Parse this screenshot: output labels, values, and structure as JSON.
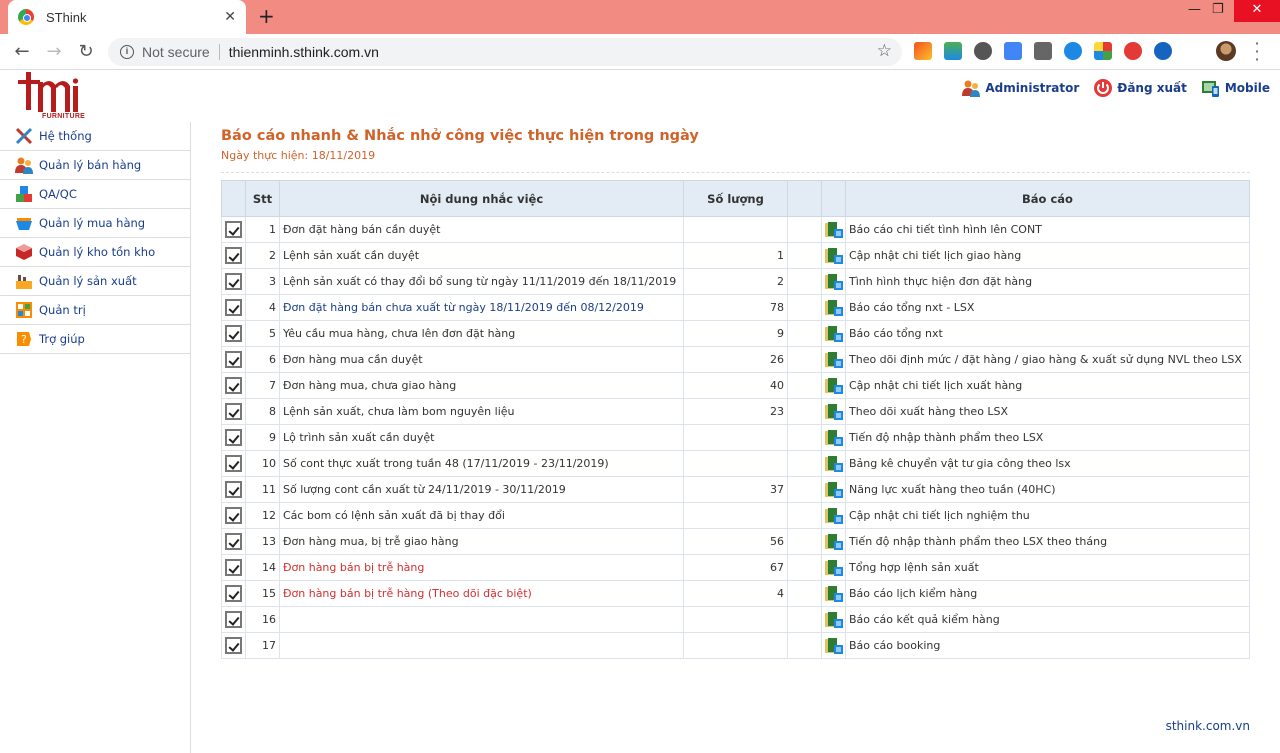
{
  "browser": {
    "tab_title": "SThink",
    "close_glyph": "✕",
    "new_tab_glyph": "+",
    "minimize_glyph": "—",
    "restore_glyph": "❐",
    "win_close_glyph": "✕",
    "not_secure": "Not secure",
    "url": "thienminh.sthink.com.vn"
  },
  "header": {
    "logo_text": "tmi",
    "logo_sub": "FURNITURE",
    "admin_label": "Administrator",
    "logout_label": "Đăng xuất",
    "mobile_label": "Mobile"
  },
  "sidebar": {
    "items": [
      {
        "label": "Hệ thống",
        "icon": "tools-icon"
      },
      {
        "label": "Quản lý bán hàng",
        "icon": "people-icon"
      },
      {
        "label": "QA/QC",
        "icon": "blocks-icon"
      },
      {
        "label": "Quản lý mua hàng",
        "icon": "basket-icon"
      },
      {
        "label": "Quản lý kho tồn kho",
        "icon": "book-icon"
      },
      {
        "label": "Quản lý sản xuất",
        "icon": "factory-icon"
      },
      {
        "label": "Quản trị",
        "icon": "grid-icon"
      },
      {
        "label": "Trợ giúp",
        "icon": "help-icon"
      }
    ]
  },
  "main": {
    "title": "Báo cáo nhanh & Nhắc nhở công việc thực hiện trong ngày",
    "date": "Ngày thực hiện: 18/11/2019",
    "columns": {
      "stt": "Stt",
      "content": "Nội dung nhắc việc",
      "qty": "Số lượng",
      "report": "Báo cáo"
    },
    "rows": [
      {
        "stt": "1",
        "content": "Đơn đặt hàng bán cần duyệt",
        "qty": "",
        "report": "Báo cáo chi tiết tình hình lên CONT",
        "style": ""
      },
      {
        "stt": "2",
        "content": "Lệnh sản xuất cần duyệt",
        "qty": "1",
        "report": "Cập nhật chi tiết lịch giao hàng",
        "style": ""
      },
      {
        "stt": "3",
        "content": "Lệnh sản xuất có thay đổi bổ sung từ ngày 11/11/2019 đến 18/11/2019",
        "qty": "2",
        "report": "Tình hình thực hiện đơn đặt hàng",
        "style": ""
      },
      {
        "stt": "4",
        "content": "Đơn đặt hàng bán chưa xuất từ ngày 18/11/2019 đến 08/12/2019",
        "qty": "78",
        "report": "Báo cáo tổng nxt - LSX",
        "style": "blue"
      },
      {
        "stt": "5",
        "content": "Yêu cầu mua hàng, chưa lên đơn đặt hàng",
        "qty": "9",
        "report": "Báo cáo tổng nxt",
        "style": ""
      },
      {
        "stt": "6",
        "content": "Đơn hàng mua cần duyệt",
        "qty": "26",
        "report": "Theo dõi định mức / đặt hàng / giao hàng & xuất sử dụng NVL theo LSX",
        "style": ""
      },
      {
        "stt": "7",
        "content": "Đơn hàng mua, chưa giao hàng",
        "qty": "40",
        "report": "Cập nhật chi tiết lịch xuất hàng",
        "style": ""
      },
      {
        "stt": "8",
        "content": "Lệnh sản xuất, chưa làm bom nguyên liệu",
        "qty": "23",
        "report": "Theo dõi xuất hàng theo LSX",
        "style": ""
      },
      {
        "stt": "9",
        "content": "Lộ trình sản xuất cần duyệt",
        "qty": "",
        "report": "Tiến độ nhập thành phẩm theo LSX",
        "style": ""
      },
      {
        "stt": "10",
        "content": "Số cont thực xuất trong tuần 48 (17/11/2019 - 23/11/2019)",
        "qty": "",
        "report": "Bảng kê chuyển vật tư gia công theo lsx",
        "style": ""
      },
      {
        "stt": "11",
        "content": "Số lượng cont cần xuất từ 24/11/2019 - 30/11/2019",
        "qty": "37",
        "report": "Năng lực xuất hàng theo tuần (40HC)",
        "style": ""
      },
      {
        "stt": "12",
        "content": "Các bom có lệnh sản xuất đã bị thay đổi",
        "qty": "",
        "report": "Cập nhật chi tiết lịch nghiệm thu",
        "style": ""
      },
      {
        "stt": "13",
        "content": "Đơn hàng mua, bị trễ giao hàng",
        "qty": "56",
        "report": "Tiến độ nhập thành phẩm theo LSX theo tháng",
        "style": ""
      },
      {
        "stt": "14",
        "content": "Đơn hàng bán bị trễ hàng",
        "qty": "67",
        "report": "Tổng hợp lệnh sản xuất",
        "style": "red"
      },
      {
        "stt": "15",
        "content": "Đơn hàng bán bị trễ hàng (Theo dõi đặc biệt)",
        "qty": "4",
        "report": "Báo cáo lịch kiểm hàng",
        "style": "red"
      },
      {
        "stt": "16",
        "content": "",
        "qty": "",
        "report": "Báo cáo kết quả kiểm hàng",
        "style": ""
      },
      {
        "stt": "17",
        "content": "",
        "qty": "",
        "report": "Báo cáo booking",
        "style": ""
      }
    ]
  },
  "footer": {
    "text": "sthink.com.vn"
  },
  "colors": {
    "accent": "#d0632a",
    "link": "#1a3e8c",
    "alert": "#d32f2f",
    "tabbar": "#f28b82",
    "table_header": "#e3ecf5"
  }
}
